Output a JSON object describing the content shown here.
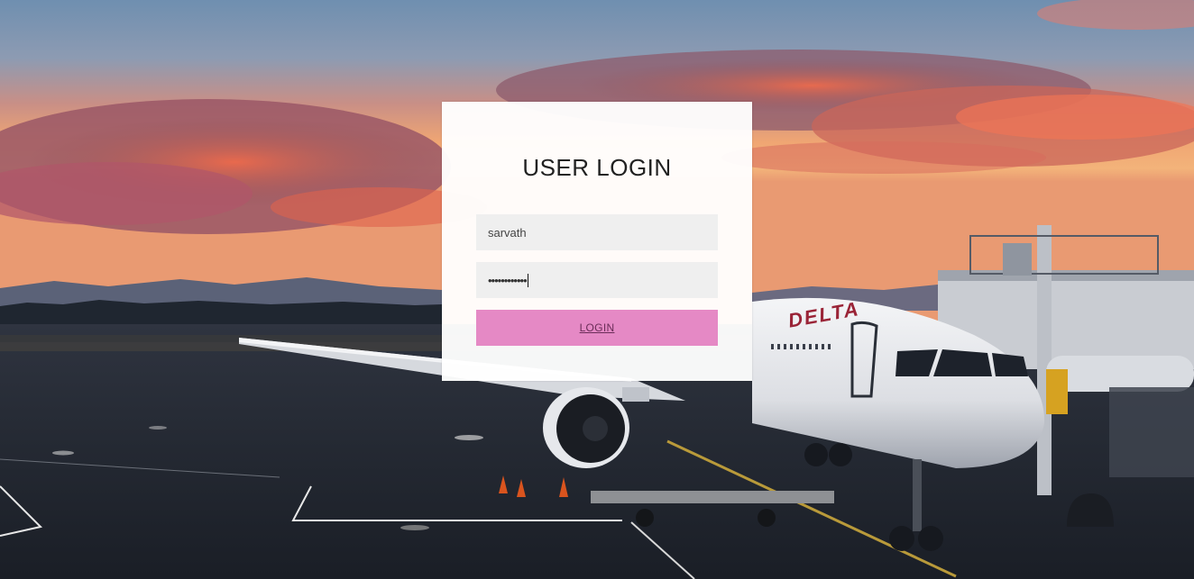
{
  "login": {
    "title": "USER LOGIN",
    "username": {
      "value": "sarvath"
    },
    "password": {
      "masked_value": "••••••••••••"
    },
    "submit_label": "LOGIN"
  },
  "background": {
    "aircraft_livery_text": "DELTA"
  },
  "colors": {
    "card_background": "#ffffff",
    "input_background": "#efefef",
    "button_background": "#e589c5"
  }
}
